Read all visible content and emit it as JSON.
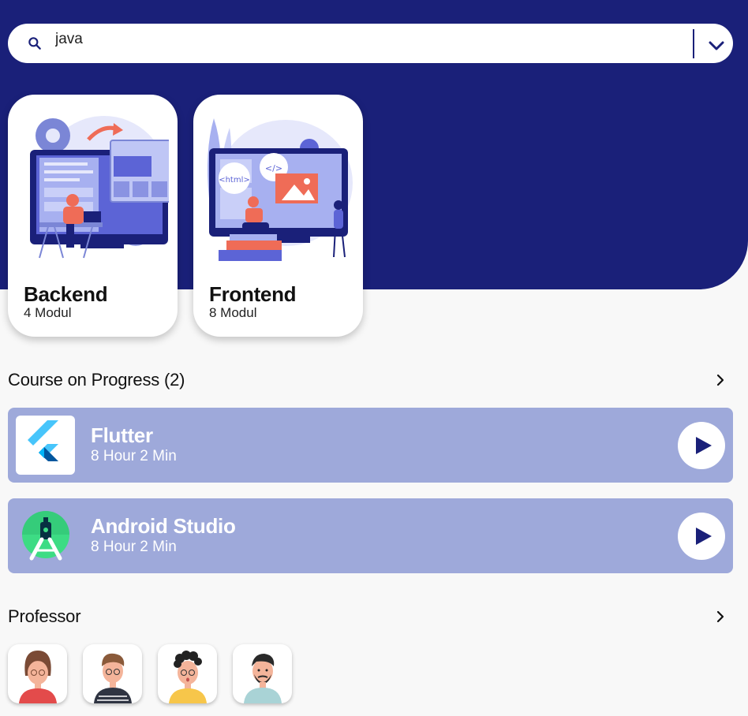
{
  "search": {
    "value": "java",
    "icon": "search-icon",
    "dropdown_icon": "chevron-down-icon"
  },
  "categories": [
    {
      "title": "Backend",
      "subtitle": "4 Modul"
    },
    {
      "title": "Frontend",
      "subtitle": "8 Modul",
      "illustration_text": [
        "<html>",
        "</>"
      ]
    }
  ],
  "progress_section": {
    "title": "Course on Progress (2)",
    "items": [
      {
        "title": "Flutter",
        "subtitle": "8 Hour 2 Min",
        "logo": "flutter-logo"
      },
      {
        "title": "Android Studio",
        "subtitle": "8 Hour 2 Min",
        "logo": "android-studio-logo"
      }
    ]
  },
  "professor_section": {
    "title": "Professor",
    "count_shown": 4
  },
  "colors": {
    "primary": "#1a2079",
    "card_bg": "#9ea9da",
    "background": "#f8f8f8"
  }
}
